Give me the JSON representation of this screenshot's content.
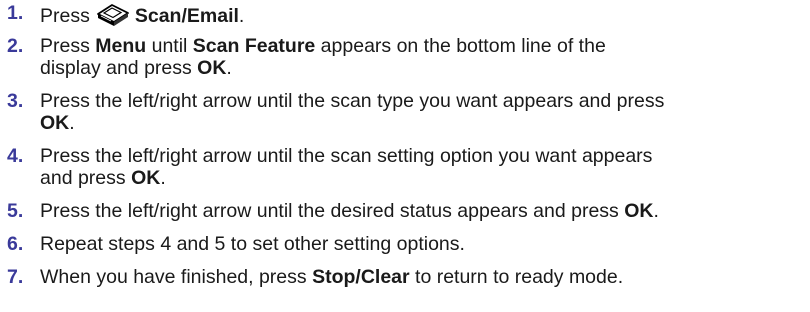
{
  "steps": [
    {
      "number": "1.",
      "text_a": "Press",
      "icon": "scanner-icon",
      "bold_a": "Scan/Email",
      "text_b": "."
    },
    {
      "number": "2.",
      "text_a": "Press ",
      "bold_a": "Menu",
      "text_b": " until ",
      "bold_b": "Scan Feature",
      "text_c": " appears on the bottom line of the",
      "line2_text_a": "display and press ",
      "line2_bold_a": "OK",
      "line2_text_b": "."
    },
    {
      "number": "3.",
      "text_a": "Press the left/right arrow until the scan type you want appears and press",
      "line2_bold_a": "OK",
      "line2_text_b": "."
    },
    {
      "number": "4.",
      "text_a": "Press the left/right arrow until the scan setting option you want appears",
      "line2_text_a": "and press ",
      "line2_bold_a": "OK",
      "line2_text_b": "."
    },
    {
      "number": "5.",
      "text_a": "Press the left/right arrow until the desired status appears and press ",
      "bold_a": "OK",
      "text_b": "."
    },
    {
      "number": "6.",
      "text_a": "Repeat steps 4 and 5 to set other setting options."
    },
    {
      "number": "7.",
      "text_a": "When you have finished, press ",
      "bold_a": "Stop/Clear",
      "text_b": " to return to ready mode."
    }
  ]
}
